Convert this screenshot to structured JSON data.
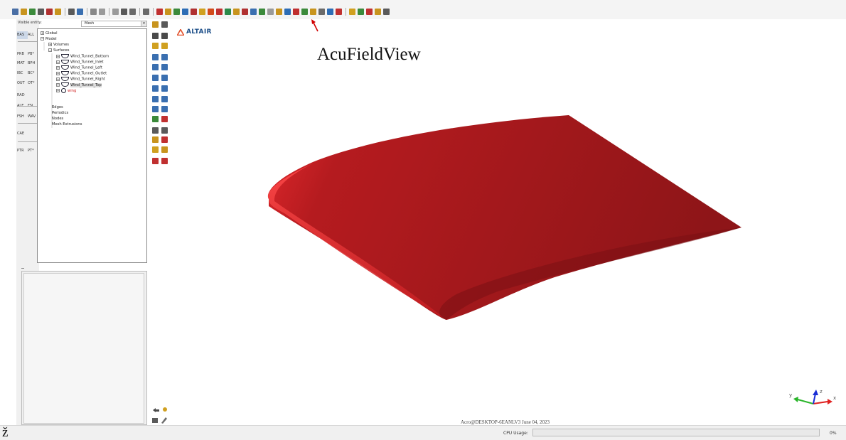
{
  "toolbar": {
    "icon_colors": [
      "#4a6fa5",
      "#c8941e",
      "#3b8a3b",
      "#5a5a5a",
      "#b03030",
      "#c8941e",
      "#5a5a5a",
      "#3a6fb0",
      "#888888",
      "#9a9a9a",
      "#9a9a9a",
      "#5a5a5a",
      "#6a6a6a",
      "#6a6a6a",
      "#c03030",
      "#c8941e",
      "#3b8a3b",
      "#2d6db5",
      "#b03030",
      "#d0a020",
      "#d24a1a",
      "#c03030",
      "#2d8a4a",
      "#c8941e",
      "#b03030",
      "#3a6fb0",
      "#3b8a3b",
      "#9a9a9a",
      "#c8941e",
      "#2d6db5",
      "#c03030",
      "#3b8a3b",
      "#c8941e",
      "#6a6a6a",
      "#2d6db5",
      "#c03030",
      "#d0a020",
      "#3b8a3b",
      "#c03030",
      "#c8941e",
      "#5a5a5a"
    ]
  },
  "left_strip": {
    "buttons": [
      {
        "label": "BAS",
        "active": true,
        "row": 0
      },
      {
        "label": "ALL",
        "active": false,
        "row": 0
      },
      {
        "label": "PRB",
        "active": false,
        "row": 1
      },
      {
        "label": "PB*",
        "active": false,
        "row": 1
      },
      {
        "label": "MAT",
        "active": false,
        "row": 2
      },
      {
        "label": "BPH",
        "active": false,
        "row": 2
      },
      {
        "label": "IBC",
        "active": false,
        "row": 3
      },
      {
        "label": "BC*",
        "active": false,
        "row": 3
      },
      {
        "label": "OUT",
        "active": false,
        "row": 4
      },
      {
        "label": "OT*",
        "active": false,
        "row": 4
      },
      {
        "label": "RAD",
        "active": false,
        "row": 5
      },
      {
        "label": "ALE",
        "active": false,
        "row": 6
      },
      {
        "label": "FSI",
        "active": false,
        "row": 6
      },
      {
        "label": "FSH",
        "active": false,
        "row": 7
      },
      {
        "label": "WAV",
        "active": false,
        "row": 7
      },
      {
        "label": "CAE",
        "active": false,
        "row": 8
      },
      {
        "label": "PTR",
        "active": false,
        "row": 9
      },
      {
        "label": "PT*",
        "active": false,
        "row": 9
      }
    ]
  },
  "visible_entity": {
    "label": "Visible entity:",
    "value": "Mesh"
  },
  "tree": {
    "global": "Global",
    "model": "Model",
    "volumes": "Volumes",
    "surfaces": "Surfaces",
    "surface_items": [
      "Wind_Tunnel_Bottom",
      "Wind_Tunnel_Inlet",
      "Wind_Tunnel_Left",
      "Wind_Tunnel_Outlet",
      "Wind_Tunnel_Right",
      "Wind_Tunnel_Top",
      "wing"
    ],
    "edges": "Edges",
    "periodics": "Periodics",
    "nodes": "Nodes",
    "mesh_extrusions": "Mesh Extrusions"
  },
  "viewport": {
    "logo_text": "ALTAIR",
    "annotation": "AcuFieldView",
    "watermark": "Acro@DESKTOP-6EANLV3 June 04, 2023",
    "wing_color": "#8e1518",
    "wing_highlight": "#e3292d"
  },
  "status": {
    "cpu_label": "CPU Usage:",
    "cpu_percent": "0%",
    "cpu_fraction": 0.0,
    "corner_char": "ž"
  },
  "triad": {
    "x_label": "x",
    "y_label": "y",
    "z_label": "z"
  }
}
